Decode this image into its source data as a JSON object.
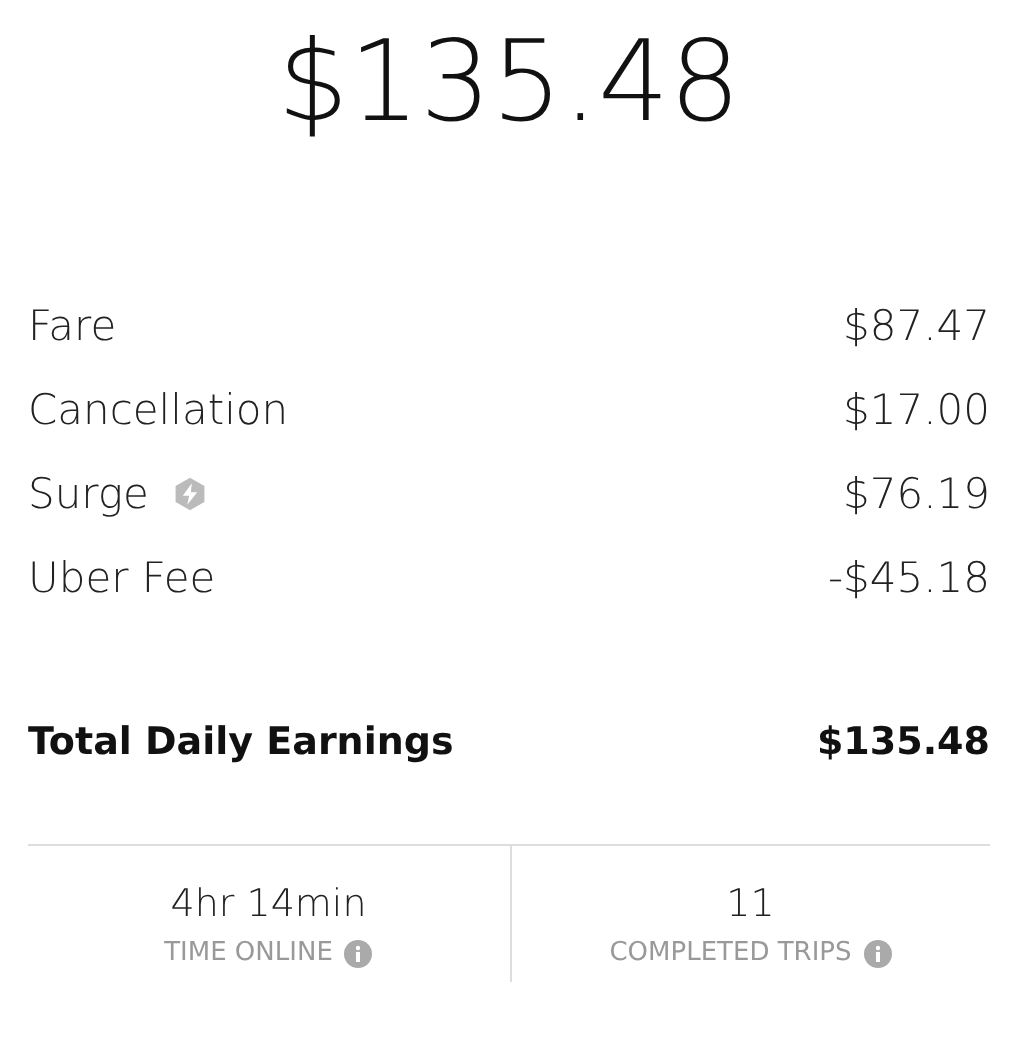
{
  "header": {
    "amount": "$135.48"
  },
  "breakdown": [
    {
      "kind": "plain",
      "label": "Fare",
      "amount": "$87.47"
    },
    {
      "kind": "plain",
      "label": "Cancellation",
      "amount": "$17.00"
    },
    {
      "kind": "surge",
      "label": "Surge",
      "amount": "$76.19"
    },
    {
      "kind": "plain",
      "label": "Uber Fee",
      "amount": "-$45.18"
    }
  ],
  "total": {
    "label": "Total Daily Earnings",
    "amount": "$135.48"
  },
  "stats": [
    {
      "value": "4hr 14min",
      "label": "TIME ONLINE"
    },
    {
      "value": "11",
      "label": "COMPLETED TRIPS"
    }
  ]
}
